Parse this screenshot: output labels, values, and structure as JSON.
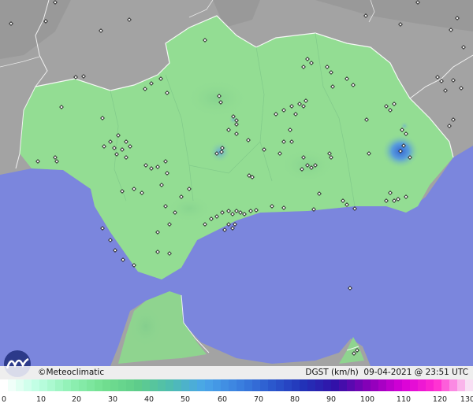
{
  "attribution": "©Meteoclimatic",
  "variable": "DGST (km/h)",
  "timestamp": "09-04-2021 @ 23:51 UTC",
  "legend": {
    "ticks": [
      "0",
      "10",
      "20",
      "30",
      "40",
      "50",
      "60",
      "70",
      "80",
      "90",
      "100",
      "110",
      "120",
      "130"
    ],
    "colors": [
      "#ffffff",
      "#bfffe4",
      "#8ff0b4",
      "#72df90",
      "#5fcd8a",
      "#4fbdb0",
      "#4aa6e8",
      "#3c83e0",
      "#2c5bcf",
      "#2233b8",
      "#3310a8",
      "#8a00b8",
      "#d800d8",
      "#ff2ad0",
      "#f8e0f4"
    ]
  },
  "colors": {
    "sea": "#7b86dd",
    "land_inside": "#93dd93",
    "land_outside": "#a4a4a4",
    "border": "#ffffff",
    "gust_highlight": "#4d8be0"
  }
}
